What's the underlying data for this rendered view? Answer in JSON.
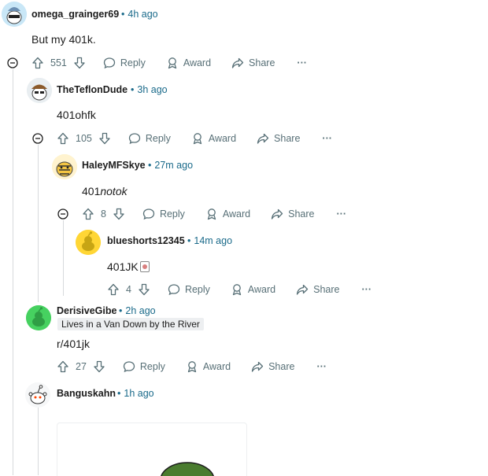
{
  "comments": [
    {
      "author": "omega_grainger69",
      "time": "4h ago",
      "body": "But my 401k.",
      "votes": "551"
    },
    {
      "author": "TheTeflonDude",
      "time": "3h ago",
      "body": "401ohfk",
      "votes": "105"
    },
    {
      "author": "HaleyMFSkye",
      "time": "27m ago",
      "body_prefix": "401",
      "body_italic": "notok",
      "votes": "8"
    },
    {
      "author": "blueshorts12345",
      "time": "14m ago",
      "body": "401JK",
      "votes": "4"
    },
    {
      "author": "DerisiveGibe",
      "time": "2h ago",
      "flair": "Lives in a Van Down by the River",
      "body": "r/401jk",
      "votes": "27"
    },
    {
      "author": "Banguskahn",
      "time": "1h ago"
    }
  ],
  "actions": {
    "reply": "Reply",
    "award": "Award",
    "share": "Share",
    "more": "···"
  },
  "time_sep": "•",
  "colors": {
    "accent_time": "#1a6a8a",
    "meta_gray": "#576f76",
    "thread_line": "#d7dadc",
    "avatar_green": "#46d160",
    "avatar_yellow": "#ffd635"
  }
}
